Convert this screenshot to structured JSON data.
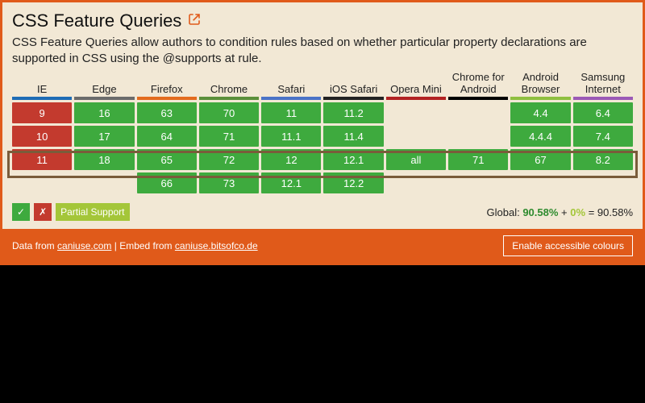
{
  "title": "CSS Feature Queries",
  "description": "CSS Feature Queries allow authors to condition rules based on whether particular property declarations are supported in CSS using the @supports at rule.",
  "legend": {
    "supported": "✓",
    "not_supported": "✗",
    "partial": "Partial Support"
  },
  "global": {
    "label": "Global:",
    "supported_pct": "90.58%",
    "partial_pct": "0%",
    "total_pct": "90.58%"
  },
  "footer": {
    "prefix": "Data from",
    "src1_label": "caniuse.com",
    "mid": "| Embed from",
    "src2_label": "caniuse.bitsofco.de",
    "button": "Enable accessible colours"
  },
  "chart_data": {
    "type": "table",
    "title": "Browser support matrix — CSS Feature Queries",
    "columns": [
      {
        "id": "ie",
        "label": "IE",
        "accent": "#1e6cb5"
      },
      {
        "id": "edge",
        "label": "Edge",
        "accent": "#6b6b6b"
      },
      {
        "id": "firefox",
        "label": "Firefox",
        "accent": "#e36b1e"
      },
      {
        "id": "chrome",
        "label": "Chrome",
        "accent": "#5a8f3a"
      },
      {
        "id": "safari",
        "label": "Safari",
        "accent": "#4a73c7"
      },
      {
        "id": "ios_safari",
        "label": "iOS Safari",
        "accent": "#222"
      },
      {
        "id": "opera_mini",
        "label": "Opera Mini",
        "accent": "#b22222"
      },
      {
        "id": "chrome_android",
        "label": "Chrome for Android",
        "accent": "#000"
      },
      {
        "id": "android_browser",
        "label": "Android Browser",
        "accent": "#8fbf3f"
      },
      {
        "id": "samsung_internet",
        "label": "Samsung Internet",
        "accent": "#9b59b6"
      }
    ],
    "current_row_index": 2,
    "rows": [
      [
        {
          "v": "9",
          "s": "nosup"
        },
        {
          "v": "16",
          "s": "sup"
        },
        {
          "v": "63",
          "s": "sup"
        },
        {
          "v": "70",
          "s": "sup"
        },
        {
          "v": "11",
          "s": "sup"
        },
        {
          "v": "11.2",
          "s": "sup"
        },
        {
          "v": "",
          "s": "empty"
        },
        {
          "v": "",
          "s": "empty"
        },
        {
          "v": "4.4",
          "s": "sup"
        },
        {
          "v": "6.4",
          "s": "sup"
        }
      ],
      [
        {
          "v": "10",
          "s": "nosup"
        },
        {
          "v": "17",
          "s": "sup"
        },
        {
          "v": "64",
          "s": "sup"
        },
        {
          "v": "71",
          "s": "sup"
        },
        {
          "v": "11.1",
          "s": "sup"
        },
        {
          "v": "11.4",
          "s": "sup"
        },
        {
          "v": "",
          "s": "empty"
        },
        {
          "v": "",
          "s": "empty"
        },
        {
          "v": "4.4.4",
          "s": "sup"
        },
        {
          "v": "7.4",
          "s": "sup"
        }
      ],
      [
        {
          "v": "11",
          "s": "nosup"
        },
        {
          "v": "18",
          "s": "sup"
        },
        {
          "v": "65",
          "s": "sup"
        },
        {
          "v": "72",
          "s": "sup"
        },
        {
          "v": "12",
          "s": "sup"
        },
        {
          "v": "12.1",
          "s": "sup"
        },
        {
          "v": "all",
          "s": "sup"
        },
        {
          "v": "71",
          "s": "sup"
        },
        {
          "v": "67",
          "s": "sup"
        },
        {
          "v": "8.2",
          "s": "sup"
        }
      ],
      [
        {
          "v": "",
          "s": "empty"
        },
        {
          "v": "",
          "s": "empty"
        },
        {
          "v": "66",
          "s": "sup"
        },
        {
          "v": "73",
          "s": "sup"
        },
        {
          "v": "12.1",
          "s": "sup"
        },
        {
          "v": "12.2",
          "s": "sup"
        },
        {
          "v": "",
          "s": "empty"
        },
        {
          "v": "",
          "s": "empty"
        },
        {
          "v": "",
          "s": "empty"
        },
        {
          "v": "",
          "s": "empty"
        }
      ]
    ]
  }
}
